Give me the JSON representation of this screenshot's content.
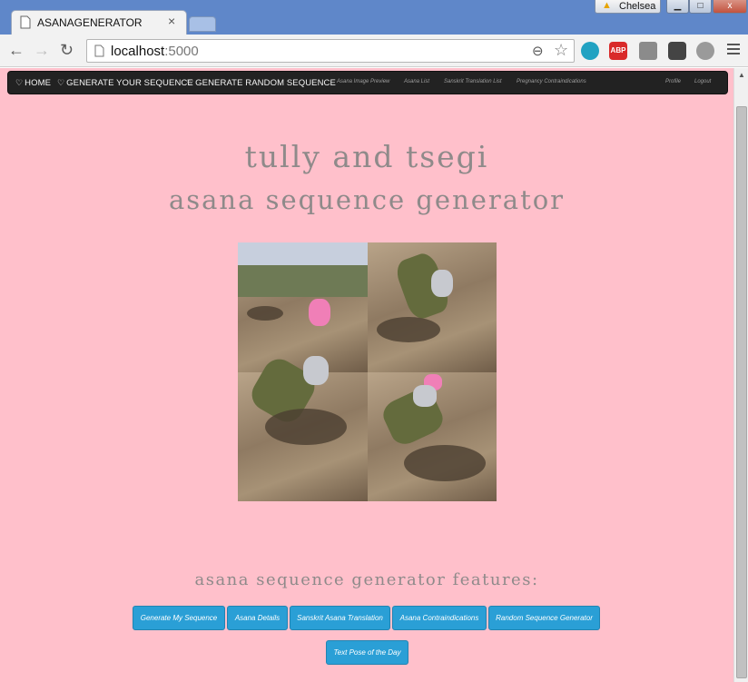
{
  "browser": {
    "tab_title": "ASANAGENERATOR",
    "profile_name": "Chelsea",
    "url_host": "localhost",
    "url_port": ":5000",
    "window_controls": {
      "minimize": "▁",
      "maximize": "□",
      "close": "x"
    },
    "extensions": [
      "ext-icon",
      "ABP",
      "ext-icon",
      "ext-icon",
      "ext-icon"
    ]
  },
  "navbar": {
    "main": [
      {
        "label": "HOME",
        "icon": "heart-icon"
      },
      {
        "label": "GENERATE YOUR SEQUENCE",
        "icon": "heart-icon"
      },
      {
        "label": "GENERATE RANDOM SEQUENCE",
        "icon": "heart-icon"
      }
    ],
    "links": [
      "Asana Image Preview",
      "Asana List",
      "Sanskrit Translation List",
      "Pregnancy Contraindications"
    ],
    "right": [
      "Profile",
      "Logout"
    ]
  },
  "hero": {
    "line1": "tully and tsegi",
    "line2": "asana sequence generator"
  },
  "features": {
    "title": "asana sequence generator features:",
    "buttons": [
      "Generate My Sequence",
      "Asana Details",
      "Sanskrit Asana Translation",
      "Asana Contraindications",
      "Random Sequence Generator",
      "Text Pose of the Day"
    ]
  },
  "colors": {
    "page_bg": "#ffc0cb",
    "navbar_bg": "#222222",
    "button_bg": "#2a9fd6",
    "heading": "#8f8a8a"
  }
}
